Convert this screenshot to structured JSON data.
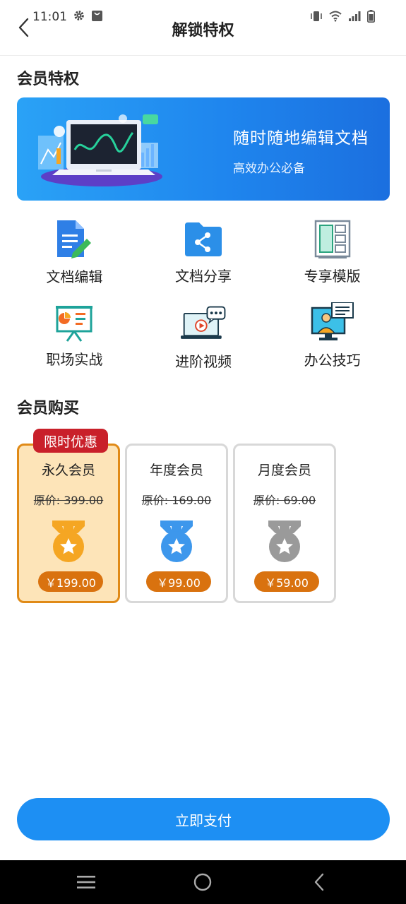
{
  "status_bar": {
    "time": "11:01"
  },
  "header": {
    "title": "解锁特权"
  },
  "privileges": {
    "section_title": "会员特权",
    "banner": {
      "title": "随时随地编辑文档",
      "subtitle": "高效办公必备"
    },
    "features": [
      {
        "label": "文档编辑",
        "icon": "doc-edit-icon"
      },
      {
        "label": "文档分享",
        "icon": "folder-share-icon"
      },
      {
        "label": "专享模版",
        "icon": "template-icon"
      },
      {
        "label": "职场实战",
        "icon": "presentation-board-icon"
      },
      {
        "label": "进阶视频",
        "icon": "video-laptop-icon"
      },
      {
        "label": "办公技巧",
        "icon": "monitor-chat-icon"
      }
    ]
  },
  "purchase": {
    "section_title": "会员购买",
    "plans": [
      {
        "name": "永久会员",
        "original": "原价: 399.00",
        "price": "￥199.00",
        "badge": "限时优惠",
        "medal_color": "#f5a623",
        "selected": true
      },
      {
        "name": "年度会员",
        "original": "原价: 169.00",
        "price": "￥99.00",
        "medal_color": "#3d97ec",
        "selected": false
      },
      {
        "name": "月度会员",
        "original": "原价: 69.00",
        "price": "￥59.00",
        "medal_color": "#9a9a9a",
        "selected": false
      }
    ],
    "pay_button": "立即支付"
  },
  "colors": {
    "accent": "#1d8ff3",
    "price": "#d9720f",
    "promo": "#c9202a",
    "selected_bg": "#fde4b8",
    "selected_border": "#e08a17"
  }
}
